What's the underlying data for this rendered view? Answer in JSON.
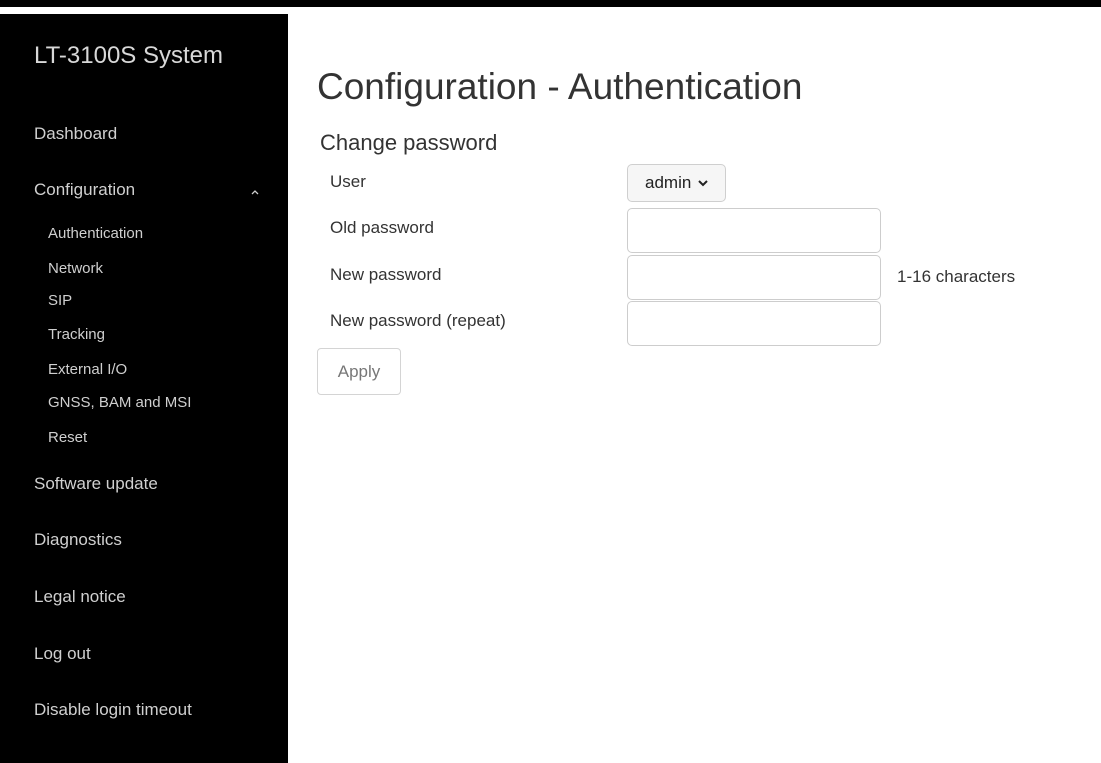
{
  "sidebar": {
    "brand": "LT-3100S System",
    "items": [
      {
        "label": "Dashboard"
      },
      {
        "label": "Configuration"
      },
      {
        "label": "Software update"
      },
      {
        "label": "Diagnostics"
      },
      {
        "label": "Legal notice"
      },
      {
        "label": "Log out"
      },
      {
        "label": "Disable login timeout"
      }
    ],
    "config_subitems": [
      {
        "label": "Authentication"
      },
      {
        "label": "Network"
      },
      {
        "label": "SIP"
      },
      {
        "label": "Tracking"
      },
      {
        "label": "External I/O"
      },
      {
        "label": "GNSS, BAM and MSI"
      },
      {
        "label": "Reset"
      }
    ],
    "config_expanded_icon": "chevron-up-icon"
  },
  "main": {
    "title": "Configuration - Authentication",
    "section_title": "Change password",
    "form": {
      "user_label": "User",
      "user_value": "admin",
      "old_password_label": "Old password",
      "old_password_value": "",
      "new_password_label": "New password",
      "new_password_value": "",
      "new_password_hint": "1-16 characters",
      "repeat_password_label": "New password (repeat)",
      "repeat_password_value": "",
      "apply_label": "Apply"
    }
  },
  "colors": {
    "sidebar_bg": "#000000",
    "sidebar_text": "#d0d0d0",
    "page_bg": "#ffffff",
    "text": "#333333"
  }
}
